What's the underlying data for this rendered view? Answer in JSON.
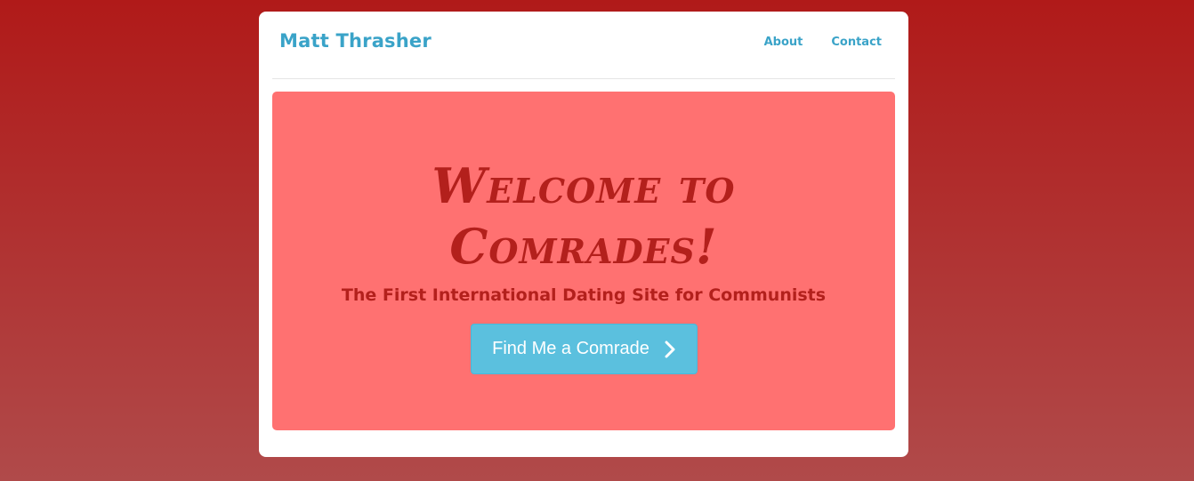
{
  "navbar": {
    "brand": "Matt Thrasher",
    "links": [
      {
        "label": "About"
      },
      {
        "label": "Contact"
      }
    ]
  },
  "hero": {
    "title_line1": "Welcome to",
    "title_line2": "Comrades!",
    "subtitle": "The First International Dating Site for Communists",
    "cta_label": "Find Me a Comrade",
    "cta_icon": "chevron-right-icon"
  },
  "colors": {
    "background_top": "#b01a19",
    "background_bottom": "#b04a4a",
    "brand": "#3aa3c8",
    "hero_bg": "#ff7171",
    "hero_text": "#b3201c",
    "button_bg": "#5bc0de"
  }
}
